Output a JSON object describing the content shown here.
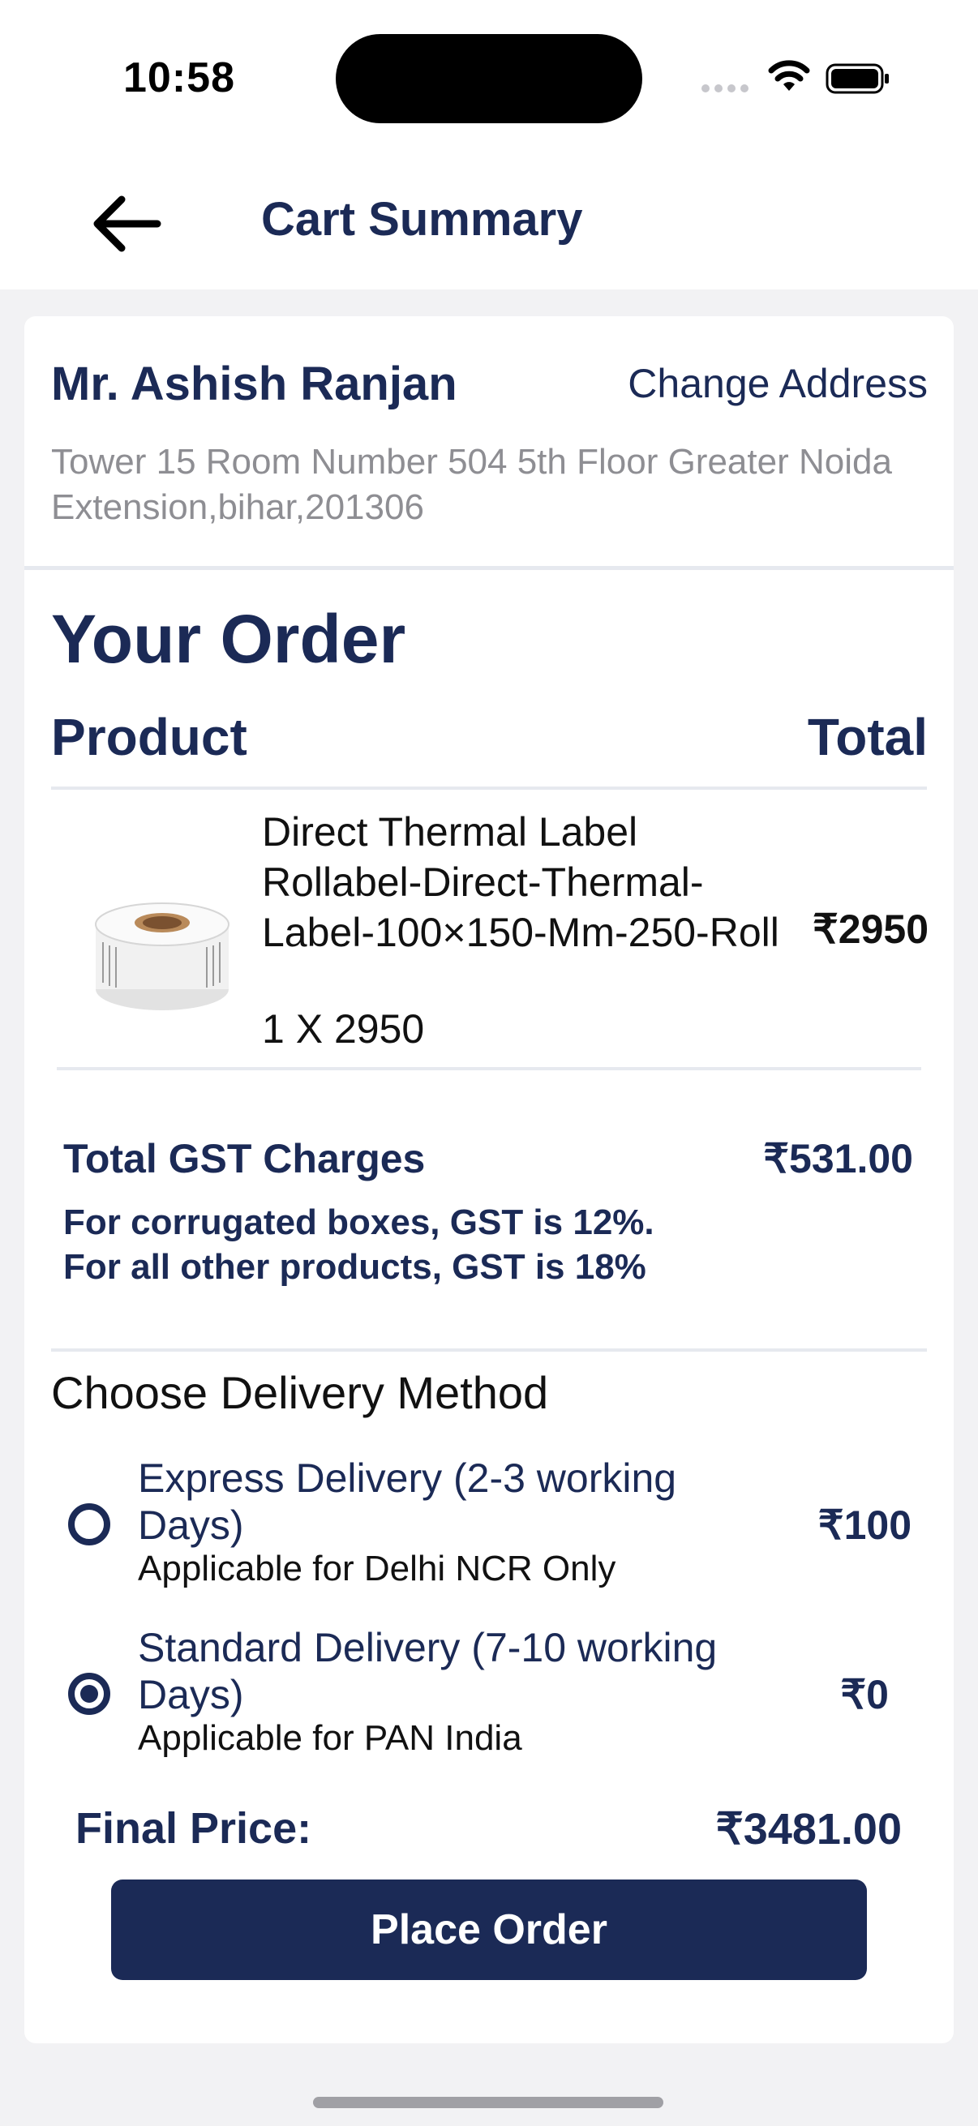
{
  "status_bar": {
    "time": "10:58"
  },
  "header": {
    "title": "Cart Summary",
    "back_icon": "arrow-left-icon"
  },
  "address": {
    "name": "Mr. Ashish Ranjan",
    "change_label": "Change Address",
    "text": "Tower 15 Room Number 504 5th Floor Greater Noida Extension,bihar,201306"
  },
  "order": {
    "heading": "Your Order",
    "col_product": "Product",
    "col_total": "Total",
    "items": [
      {
        "name": "Direct Thermal Label Rollabel-Direct-Thermal-Label-100×150-Mm-250-Roll",
        "qty_line": "1 X 2950",
        "price": "₹2950"
      }
    ]
  },
  "gst": {
    "label": "Total GST Charges",
    "value": "₹531.00",
    "note": "For corrugated boxes, GST is 12%. For all other products, GST is 18%"
  },
  "delivery": {
    "heading": "Choose Delivery Method",
    "options": [
      {
        "title": "Express Delivery (2-3 working Days)",
        "subtitle": "Applicable for Delhi NCR Only",
        "price": "₹100",
        "selected": false
      },
      {
        "title": "Standard Delivery (7-10 working Days)",
        "subtitle": "Applicable for PAN India",
        "price": "₹0",
        "selected": true
      }
    ]
  },
  "final": {
    "label": "Final Price:",
    "value": "₹3481.00"
  },
  "place_order_label": "Place Order",
  "colors": {
    "primary": "#1b2a56",
    "muted": "#8e8e93",
    "divider": "#e6e9ef",
    "background": "#f2f2f4"
  }
}
